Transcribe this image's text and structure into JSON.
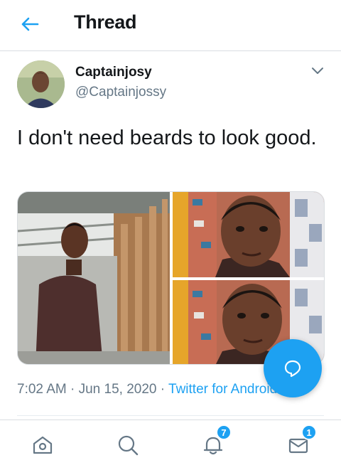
{
  "header": {
    "title": "Thread"
  },
  "tweet": {
    "display_name": "Captainjosy",
    "handle": "@Captainjossy",
    "text": "I don't need beards to look good.",
    "time": "7:02 AM",
    "date": "Jun 15, 2020",
    "source": "Twitter for Android"
  },
  "nav": {
    "notifications_badge": "7",
    "messages_badge": "1"
  },
  "colors": {
    "accent": "#1da1f2",
    "muted": "#657786",
    "text": "#14171a"
  },
  "icons": [
    "back-arrow-icon",
    "chevron-down-icon",
    "home-icon",
    "search-icon",
    "bell-icon",
    "mail-icon",
    "compose-reply-icon"
  ]
}
